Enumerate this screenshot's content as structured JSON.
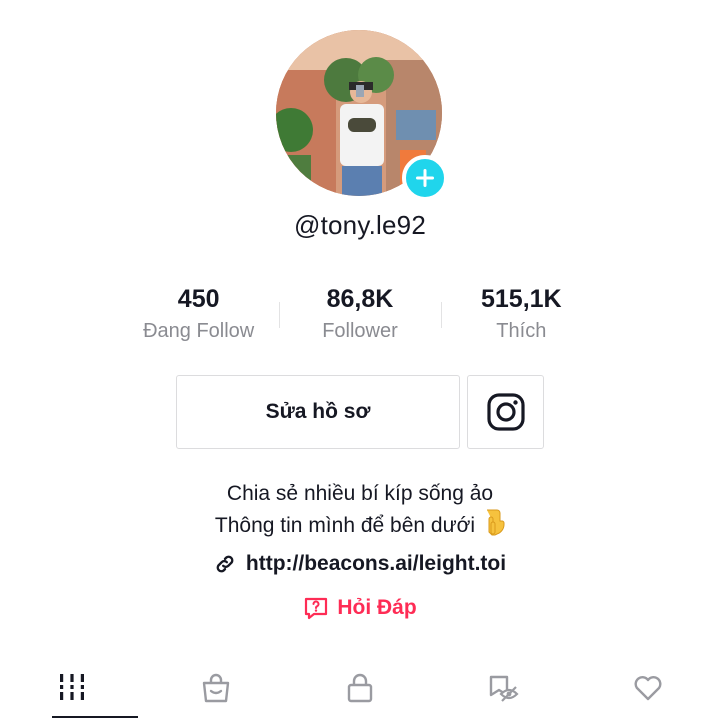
{
  "profile": {
    "username": "@tony.le92",
    "avatar_alt": "",
    "add_icon": "plus-icon"
  },
  "stats": [
    {
      "value": "450",
      "label": "Đang Follow"
    },
    {
      "value": "86,8K",
      "label": "Follower"
    },
    {
      "value": "515,1K",
      "label": "Thích"
    }
  ],
  "actions": {
    "edit_label": "Sửa hồ sơ",
    "instagram_icon": "instagram-icon"
  },
  "bio": {
    "line1": "Chia sẻ nhiều bí kíp sống ảo",
    "line2": "Thông tin mình để bên dưới",
    "emoji_icon": "pointing-down-icon"
  },
  "link": {
    "url": "http://beacons.ai/leight.toi",
    "icon": "link-icon"
  },
  "qa": {
    "label": "Hỏi Đáp",
    "icon": "question-icon",
    "color": "#fe2c55"
  },
  "tabs": [
    {
      "icon": "grid-icon",
      "active": true
    },
    {
      "icon": "shopping-bag-icon",
      "active": false
    },
    {
      "icon": "lock-icon",
      "active": false
    },
    {
      "icon": "repost-eye-off-icon",
      "active": false
    },
    {
      "icon": "heart-icon",
      "active": false
    }
  ],
  "colors": {
    "accent": "#20d5ec",
    "text": "#161823",
    "muted": "#8a8b91",
    "qa": "#fe2c55"
  }
}
